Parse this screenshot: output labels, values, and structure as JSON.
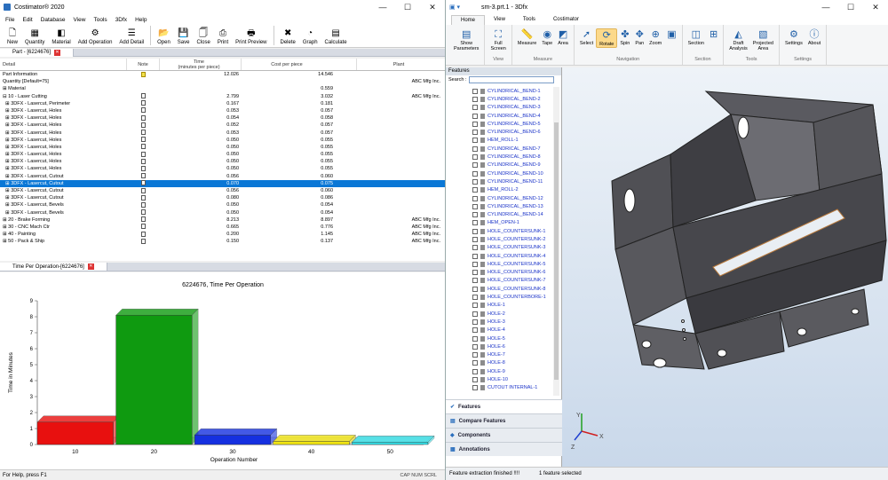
{
  "left": {
    "title": "Costimator® 2020",
    "menu": [
      "File",
      "Edit",
      "Database",
      "View",
      "Tools",
      "3Dfx",
      "Help"
    ],
    "toolbar": [
      {
        "label": "New",
        "icon": "new-doc-icon",
        "glyph": "🗋"
      },
      {
        "label": "Quantity",
        "icon": "quantity-icon",
        "glyph": "▦"
      },
      {
        "label": "Material",
        "icon": "material-icon",
        "glyph": "◧"
      },
      {
        "label": "Add Operation",
        "icon": "add-operation-icon",
        "glyph": "⚙"
      },
      {
        "label": "Add Detail",
        "icon": "add-detail-icon",
        "glyph": "☰"
      },
      {
        "label": "Open",
        "icon": "open-folder-icon",
        "glyph": "📂"
      },
      {
        "label": "Save",
        "icon": "save-icon",
        "glyph": "💾"
      },
      {
        "label": "Close",
        "icon": "close-doc-icon",
        "glyph": "🗍"
      },
      {
        "label": "Print",
        "icon": "print-icon",
        "glyph": "⎙"
      },
      {
        "label": "Print Preview",
        "icon": "print-preview-icon",
        "glyph": "🖶"
      },
      {
        "label": "Delete",
        "icon": "delete-icon",
        "glyph": "✖"
      },
      {
        "label": "Graph",
        "icon": "graph-icon",
        "glyph": "◔"
      },
      {
        "label": "Calculate",
        "icon": "calculate-icon",
        "glyph": "▤"
      }
    ],
    "part_tab": "Part - [6224676]",
    "columns": [
      "Detail",
      "Note",
      "Time\n(minutes per piece)",
      "Cost per piece",
      "Plant"
    ],
    "rows": [
      {
        "detail": "Part Information",
        "note": "yellow",
        "time": "12.026",
        "cost": "14.546",
        "plant": ""
      },
      {
        "detail": "Quantity [Default=75]",
        "note": "",
        "time": "",
        "cost": "",
        "plant": "ABC Mfg Inc."
      },
      {
        "detail": "⊞ Material",
        "note": "",
        "time": "",
        "cost": "0.559",
        "plant": ""
      },
      {
        "detail": "⊟ 10 - Laser Cutting",
        "note": "doc",
        "time": "2.799",
        "cost": "3.032",
        "plant": "ABC Mfg Inc."
      },
      {
        "detail": "  ⊞ 3DFX - Lasercut, Perimeter",
        "note": "doc",
        "time": "0.167",
        "cost": "0.181",
        "plant": ""
      },
      {
        "detail": "  ⊞ 3DFX - Lasercut, Holes",
        "note": "doc",
        "time": "0.053",
        "cost": "0.057",
        "plant": ""
      },
      {
        "detail": "  ⊞ 3DFX - Lasercut, Holes",
        "note": "doc",
        "time": "0.054",
        "cost": "0.058",
        "plant": ""
      },
      {
        "detail": "  ⊞ 3DFX - Lasercut, Holes",
        "note": "doc",
        "time": "0.052",
        "cost": "0.057",
        "plant": ""
      },
      {
        "detail": "  ⊞ 3DFX - Lasercut, Holes",
        "note": "doc",
        "time": "0.053",
        "cost": "0.057",
        "plant": ""
      },
      {
        "detail": "  ⊞ 3DFX - Lasercut, Holes",
        "note": "doc",
        "time": "0.050",
        "cost": "0.055",
        "plant": ""
      },
      {
        "detail": "  ⊞ 3DFX - Lasercut, Holes",
        "note": "doc",
        "time": "0.050",
        "cost": "0.055",
        "plant": ""
      },
      {
        "detail": "  ⊞ 3DFX - Lasercut, Holes",
        "note": "doc",
        "time": "0.050",
        "cost": "0.055",
        "plant": ""
      },
      {
        "detail": "  ⊞ 3DFX - Lasercut, Holes",
        "note": "doc",
        "time": "0.050",
        "cost": "0.055",
        "plant": ""
      },
      {
        "detail": "  ⊞ 3DFX - Lasercut, Holes",
        "note": "doc",
        "time": "0.050",
        "cost": "0.055",
        "plant": ""
      },
      {
        "detail": "  ⊞ 3DFX - Lasercut, Cutout",
        "note": "doc",
        "time": "0.056",
        "cost": "0.060",
        "plant": ""
      },
      {
        "detail": "  ⊞ 3DFX - Lasercut, Cutout",
        "note": "doc",
        "time": "0.070",
        "cost": "0.075",
        "plant": "",
        "selected": true
      },
      {
        "detail": "  ⊞ 3DFX - Lasercut, Cutout",
        "note": "doc",
        "time": "0.056",
        "cost": "0.060",
        "plant": ""
      },
      {
        "detail": "  ⊞ 3DFX - Lasercut, Cutout",
        "note": "doc",
        "time": "0.080",
        "cost": "0.086",
        "plant": ""
      },
      {
        "detail": "  ⊞ 3DFX - Lasercut, Bevels",
        "note": "doc",
        "time": "0.050",
        "cost": "0.054",
        "plant": ""
      },
      {
        "detail": "  ⊞ 3DFX - Lasercut, Bevels",
        "note": "doc",
        "time": "0.050",
        "cost": "0.054",
        "plant": ""
      },
      {
        "detail": "⊞ 20 - Brake Forming",
        "note": "doc",
        "time": "8.213",
        "cost": "8.897",
        "plant": "ABC Mfg Inc."
      },
      {
        "detail": "⊞ 30 - CNC Mach Ctr",
        "note": "doc",
        "time": "0.665",
        "cost": "0.776",
        "plant": "ABC Mfg Inc."
      },
      {
        "detail": "⊞ 40 - Painting",
        "note": "doc",
        "time": "0.200",
        "cost": "1.145",
        "plant": "ABC Mfg Inc."
      },
      {
        "detail": "⊞ 50 - Pack & Ship",
        "note": "doc",
        "time": "0.150",
        "cost": "0.137",
        "plant": "ABC Mfg Inc."
      }
    ],
    "chart_tab": "Time Per Operation-[6224676]",
    "status": "For Help, press F1",
    "status_right": "CAP  NUM  SCRL"
  },
  "chart_data": {
    "type": "bar",
    "title": "6224676, Time Per Operation",
    "xlabel": "Operation Number",
    "ylabel": "Time in Minutes",
    "categories": [
      "10",
      "20",
      "30",
      "40",
      "50"
    ],
    "values": [
      1.4,
      8.1,
      0.6,
      0.2,
      0.15
    ],
    "colors": [
      "#e8100f",
      "#0f9a10",
      "#1530e0",
      "#f0e412",
      "#35e0e8"
    ],
    "ylim": [
      0,
      9
    ],
    "yticks": [
      "0",
      "1",
      "2",
      "3",
      "4",
      "5",
      "6",
      "7",
      "8",
      "9"
    ],
    "grid": false
  },
  "right": {
    "title": "sm-3.prt.1 - 3Dfx",
    "tabs": [
      "Home",
      "View",
      "Tools",
      "Costimator"
    ],
    "groups": [
      {
        "label": "",
        "buttons": [
          {
            "label": "Show\nParameters",
            "glyph": "▤",
            "icon": "show-parameters-icon"
          }
        ]
      },
      {
        "label": "View",
        "buttons": [
          {
            "label": "Full\nScreen",
            "glyph": "⛶",
            "icon": "full-screen-icon"
          }
        ]
      },
      {
        "label": "Measure",
        "buttons": [
          {
            "label": "Measure",
            "glyph": "📏",
            "icon": "measure-icon"
          },
          {
            "label": "Tape",
            "glyph": "◉",
            "icon": "tape-icon"
          },
          {
            "label": "Area",
            "glyph": "◩",
            "icon": "area-icon"
          }
        ]
      },
      {
        "label": "Navigation",
        "buttons": [
          {
            "label": "Select",
            "glyph": "➚",
            "icon": "select-icon"
          },
          {
            "label": "Rotate",
            "glyph": "⟳",
            "icon": "rotate-icon",
            "active": true
          },
          {
            "label": "Spin",
            "glyph": "✤",
            "icon": "spin-icon"
          },
          {
            "label": "Pan",
            "glyph": "✥",
            "icon": "pan-icon"
          },
          {
            "label": "Zoom",
            "glyph": "⊕",
            "icon": "zoom-icon"
          },
          {
            "label": "",
            "glyph": "▣",
            "icon": "zoom-box-icon"
          }
        ]
      },
      {
        "label": "Section",
        "buttons": [
          {
            "label": "Section",
            "glyph": "◫",
            "icon": "section-icon"
          },
          {
            "label": "",
            "glyph": "⊞",
            "icon": "section-options-icon"
          }
        ]
      },
      {
        "label": "Tools",
        "buttons": [
          {
            "label": "Draft\nAnalysis",
            "glyph": "◭",
            "icon": "draft-analysis-icon"
          },
          {
            "label": "Projected\nArea",
            "glyph": "▧",
            "icon": "projected-area-icon"
          }
        ]
      },
      {
        "label": "Settings",
        "buttons": [
          {
            "label": "Settings",
            "glyph": "⚙",
            "icon": "settings-icon"
          },
          {
            "label": "About",
            "glyph": "ⓘ",
            "icon": "about-icon"
          }
        ]
      }
    ],
    "features_header": "Features",
    "search_label": "Search :",
    "features": [
      "CYLINDRICAL_BEND-1",
      "CYLINDRICAL_BEND-2",
      "CYLINDRICAL_BEND-3",
      "CYLINDRICAL_BEND-4",
      "CYLINDRICAL_BEND-5",
      "CYLINDRICAL_BEND-6",
      "HEM_ROLL-1",
      "CYLINDRICAL_BEND-7",
      "CYLINDRICAL_BEND-8",
      "CYLINDRICAL_BEND-9",
      "CYLINDRICAL_BEND-10",
      "CYLINDRICAL_BEND-11",
      "HEM_ROLL-2",
      "CYLINDRICAL_BEND-12",
      "CYLINDRICAL_BEND-13",
      "CYLINDRICAL_BEND-14",
      "HEM_OPEN-1",
      "HOLE_COUNTERSUNK-1",
      "HOLE_COUNTERSUNK-2",
      "HOLE_COUNTERSUNK-3",
      "HOLE_COUNTERSUNK-4",
      "HOLE_COUNTERSUNK-5",
      "HOLE_COUNTERSUNK-6",
      "HOLE_COUNTERSUNK-7",
      "HOLE_COUNTERSUNK-8",
      "HOLE_COUNTERBORE-1",
      "HOLE-1",
      "HOLE-2",
      "HOLE-3",
      "HOLE-4",
      "HOLE-5",
      "HOLE-6",
      "HOLE-7",
      "HOLE-8",
      "HOLE-9",
      "HOLE-10",
      "CUTOUT INTERNAL-1"
    ],
    "accordion": [
      "Features",
      "Compare Features",
      "Components",
      "Annotations"
    ],
    "status_left": "Feature extraction finished !!!!",
    "status_right": "1 feature selected"
  }
}
